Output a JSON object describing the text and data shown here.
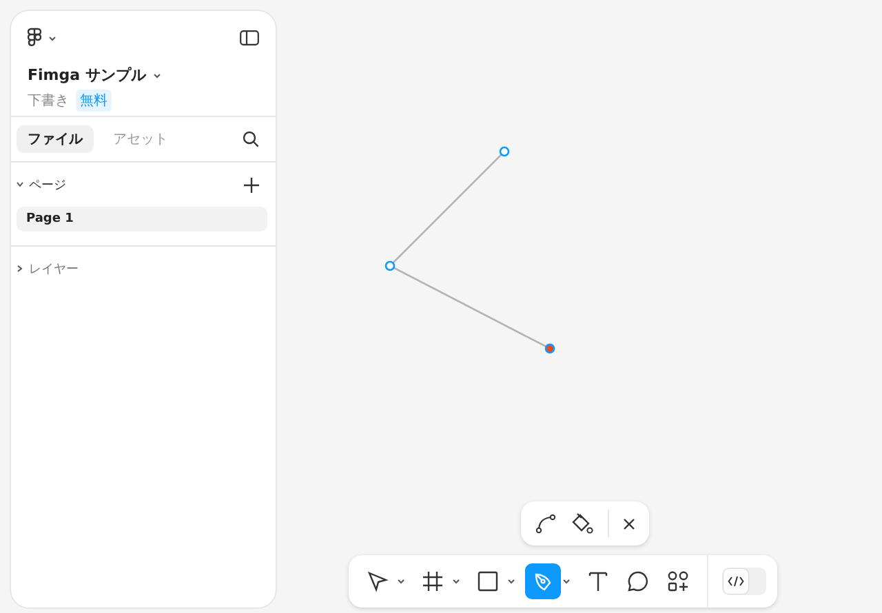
{
  "file": {
    "name": "Fimga サンプル",
    "status": "下書き",
    "plan": "無料"
  },
  "tabs": [
    {
      "label": "ファイル",
      "selected": true
    },
    {
      "label": "アセット",
      "selected": false
    }
  ],
  "pages": {
    "title": "ページ",
    "expanded": true,
    "items": [
      {
        "label": "Page 1",
        "selected": true
      }
    ]
  },
  "layers": {
    "title": "レイヤー",
    "expanded": false
  },
  "path_actions": [
    {
      "kind": "bend"
    },
    {
      "kind": "paint"
    },
    {
      "kind": "close"
    }
  ],
  "tools": [
    {
      "kind": "move",
      "selected": false,
      "menu": true
    },
    {
      "kind": "frame",
      "selected": false,
      "menu": true
    },
    {
      "kind": "rect",
      "selected": false,
      "menu": true
    },
    {
      "kind": "pen",
      "selected": true,
      "menu": true
    },
    {
      "kind": "text",
      "selected": false,
      "menu": false
    },
    {
      "kind": "comment",
      "selected": false,
      "menu": false
    },
    {
      "kind": "actions",
      "selected": false,
      "menu": false
    }
  ],
  "dev_mode": {
    "on": false
  }
}
